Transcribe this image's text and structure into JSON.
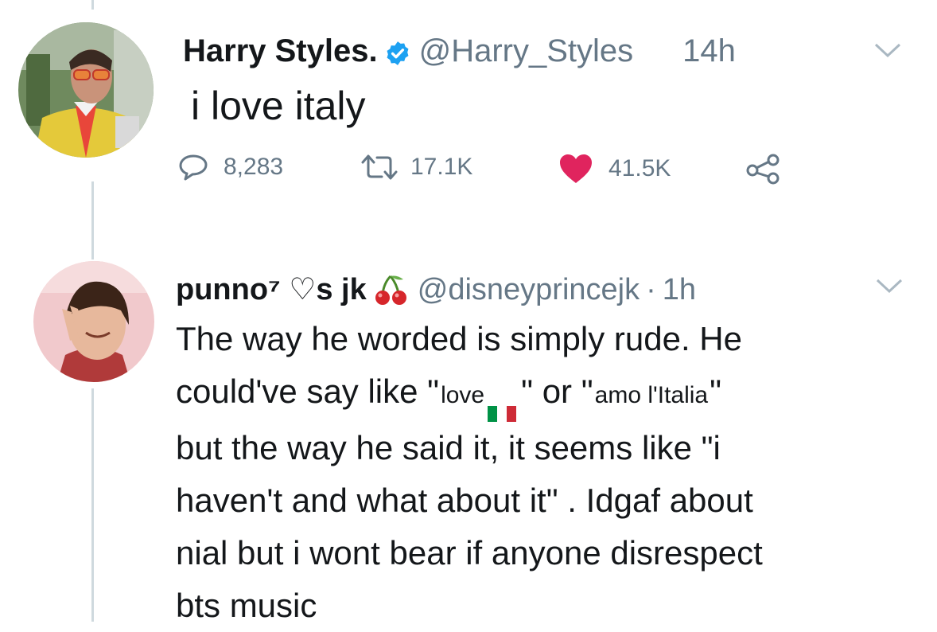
{
  "tweet": {
    "display_name": "Harry Styles.",
    "handle": "@Harry_Styles",
    "time": "14h",
    "text": "i love italy",
    "stats": {
      "replies": "8,283",
      "retweets": "17.1K",
      "likes": "41.5K"
    }
  },
  "reply": {
    "display_name": "punno⁷ ♡s jk",
    "handle": "@disneyprincejk",
    "separator": "·",
    "time": "1h",
    "lines": [
      "The way he worded is simply rude. He",
      "could've say like \"",
      "\" or \"",
      "\"",
      "but the way he said it, it seems like \"i",
      "haven't and what about it\" . Idgaf about",
      "nial but i wont bear if anyone disrespect",
      "bts music"
    ],
    "sticker_love": "love",
    "sticker_italia": "amo l'Italia"
  },
  "icons": {
    "verified": "verified-badge-icon",
    "reply": "comment-bubble-icon",
    "retweet": "retweet-icon",
    "like": "heart-icon",
    "share": "share-icon",
    "caret": "chevron-down-icon",
    "cherry": "cherries-icon"
  },
  "colors": {
    "verified": "#1da1f2",
    "like": "#e0245e",
    "muted": "#657786"
  }
}
